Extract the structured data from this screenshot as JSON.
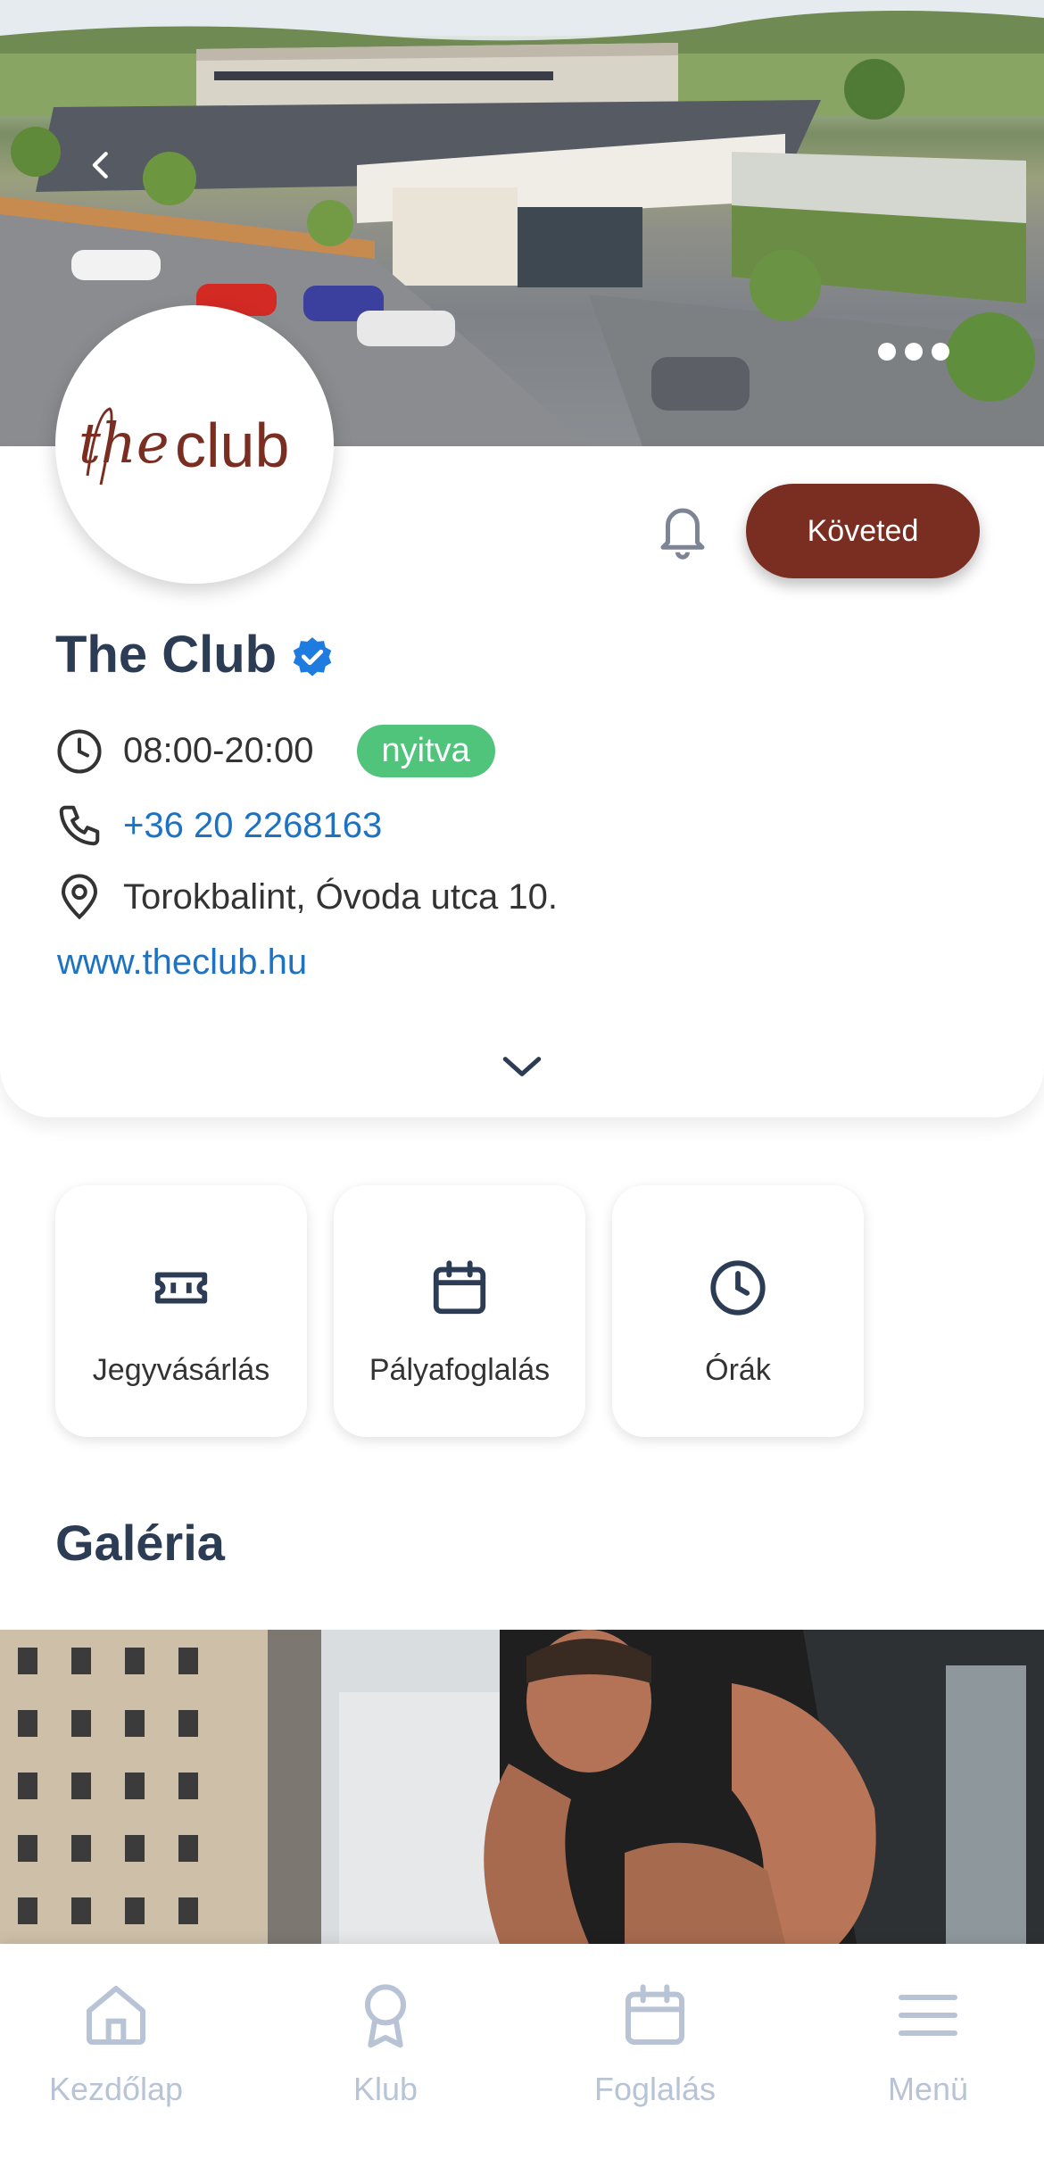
{
  "hero": {
    "logo_sign_text": "the club",
    "carousel_dots": 3
  },
  "profile": {
    "logo_text": "the club",
    "follow_label": "Követed",
    "name": "The Club",
    "hours": "08:00-20:00",
    "status": "nyitva",
    "phone": "+36 20 2268163",
    "address": "Torokbalint, Óvoda utca 10.",
    "website": "www.theclub.hu"
  },
  "actions": [
    {
      "label": "Jegyvásárlás",
      "icon": "ticket-icon"
    },
    {
      "label": "Pályafoglalás",
      "icon": "calendar-icon"
    },
    {
      "label": "Órák",
      "icon": "clock-icon"
    }
  ],
  "gallery": {
    "title": "Galéria"
  },
  "nav": [
    {
      "label": "Kezdőlap",
      "icon": "home-icon"
    },
    {
      "label": "Klub",
      "icon": "award-icon"
    },
    {
      "label": "Foglalás",
      "icon": "calendar-icon"
    },
    {
      "label": "Menü",
      "icon": "hamburger-icon"
    }
  ],
  "colors": {
    "brand": "#7a2e22",
    "primary_text": "#2d3c55",
    "link": "#1d72c2",
    "status_open": "#4fc47a",
    "nav_inactive": "#b8c4d6",
    "verified": "#1e7be0"
  }
}
